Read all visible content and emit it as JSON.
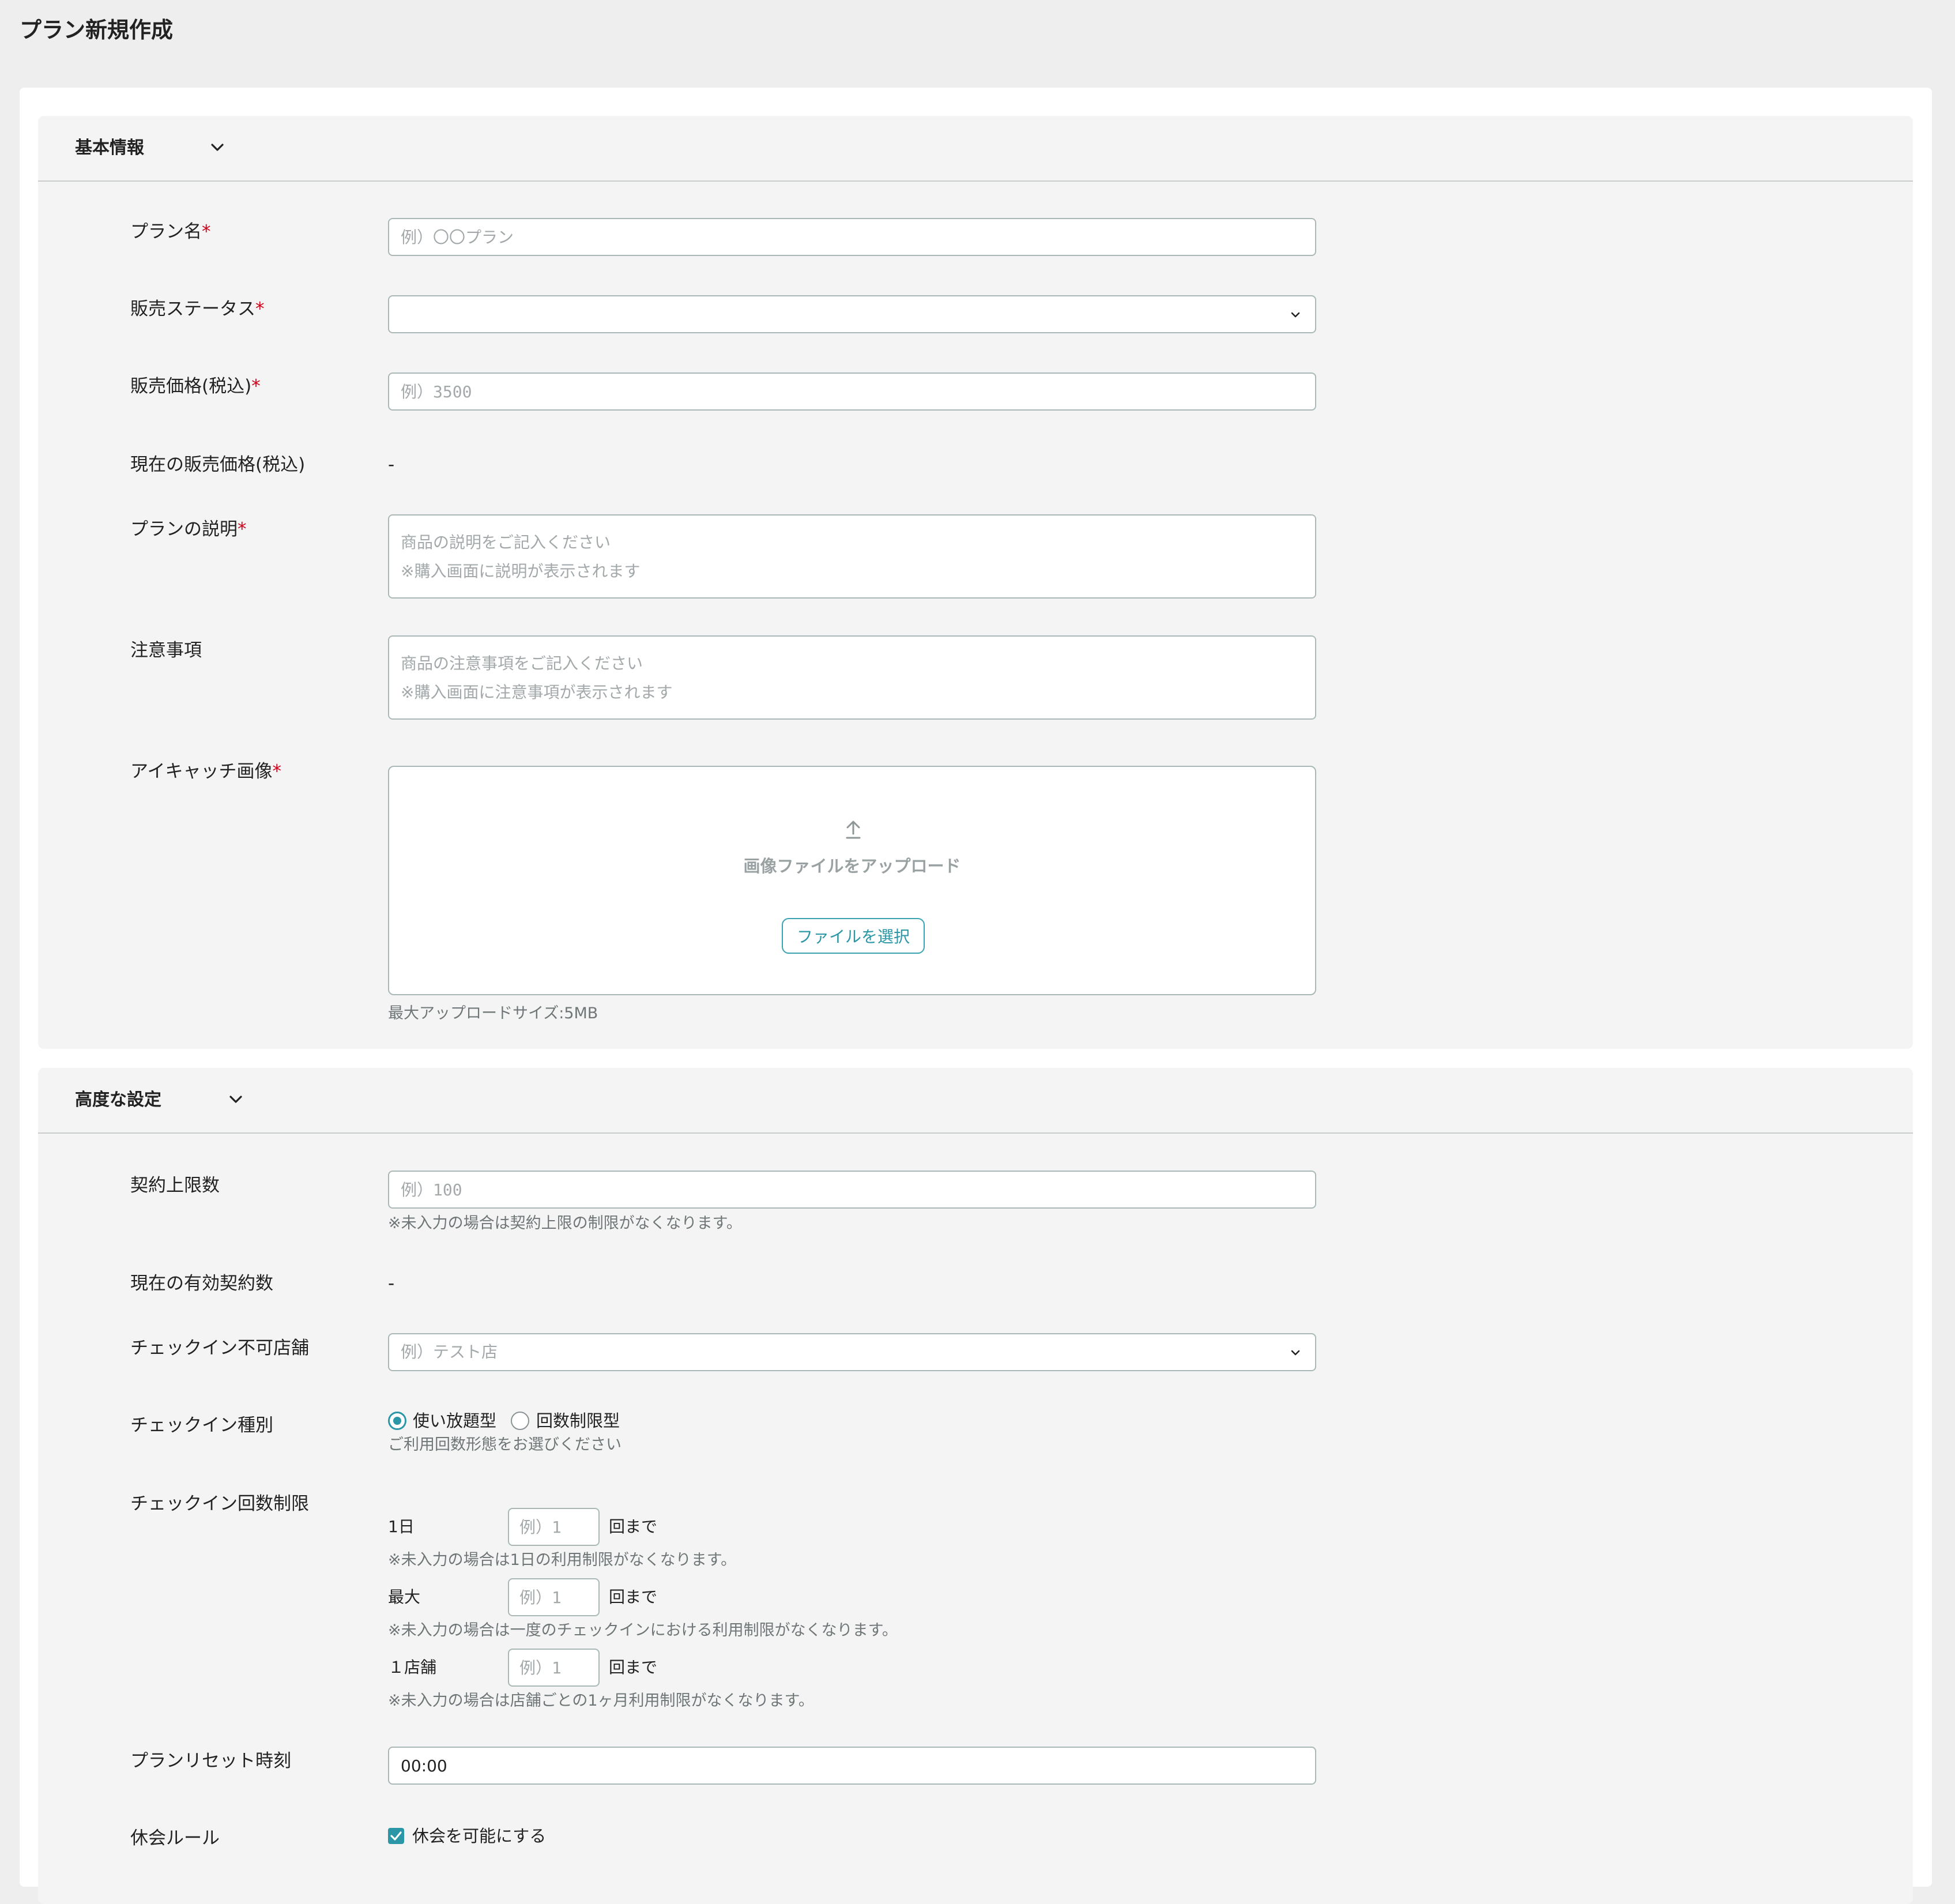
{
  "page": {
    "title": "プラン新規作成"
  },
  "sections": {
    "basic": {
      "title": "基本情報"
    },
    "advanced": {
      "title": "高度な設定"
    }
  },
  "basic": {
    "plan_name": {
      "label": "プラン名",
      "required_mark": "*",
      "placeholder": "例）〇〇プラン",
      "value": ""
    },
    "sales_status": {
      "label": "販売ステータス",
      "required_mark": "*",
      "selected": ""
    },
    "sales_price": {
      "label": "販売価格(税込)",
      "required_mark": "*",
      "placeholder": "例）3500",
      "value": ""
    },
    "current_price": {
      "label": "現在の販売価格(税込)",
      "value": "-"
    },
    "description": {
      "label": "プランの説明",
      "required_mark": "*",
      "placeholder": "商品の説明をご記入ください\n※購入画面に説明が表示されます"
    },
    "notes": {
      "label": "注意事項",
      "placeholder": "商品の注意事項をご記入ください\n※購入画面に注意事項が表示されます"
    },
    "eyecatch": {
      "label": "アイキャッチ画像",
      "required_mark": "*",
      "upload_text": "画像ファイルをアップロード",
      "button_label": "ファイルを選択",
      "max_size_hint": "最大アップロードサイズ:5MB",
      "icon": "upload-icon"
    }
  },
  "advanced": {
    "contract_limit": {
      "label": "契約上限数",
      "placeholder": "例）100",
      "hint": "※未入力の場合は契約上限の制限がなくなります。"
    },
    "active_contracts": {
      "label": "現在の有効契約数",
      "value": "-"
    },
    "checkin_excluded_stores": {
      "label": "チェックイン不可店舗",
      "placeholder": "例）テスト店"
    },
    "checkin_type": {
      "label": "チェックイン種別",
      "options": [
        {
          "label": "使い放題型",
          "selected": true
        },
        {
          "label": "回数制限型",
          "selected": false
        }
      ],
      "hint": "ご利用回数形態をお選びください"
    },
    "checkin_limits": {
      "label": "チェックイン回数制限",
      "rows": [
        {
          "label": "1日",
          "placeholder": "例）1",
          "unit": "回まで",
          "hint": "※未入力の場合は1日の利用制限がなくなります。"
        },
        {
          "label": "最大",
          "placeholder": "例）1",
          "unit": "回まで",
          "hint": "※未入力の場合は一度のチェックインにおける利用制限がなくなります。"
        },
        {
          "label": "１店舗",
          "placeholder": "例）1",
          "unit": "回まで",
          "hint": "※未入力の場合は店舗ごとの1ヶ月利用制限がなくなります。"
        }
      ]
    },
    "plan_reset_time": {
      "label": "プランリセット時刻",
      "value": "00:00"
    },
    "suspension_rule": {
      "label": "休会ルール",
      "checkbox_label": "休会を可能にする",
      "checked": true
    }
  },
  "colors": {
    "accent": "#2b97a6",
    "required": "#d0021b",
    "page_bg": "#eeeeee",
    "section_bg": "#f4f4f4",
    "border": "#a9b7b7"
  }
}
